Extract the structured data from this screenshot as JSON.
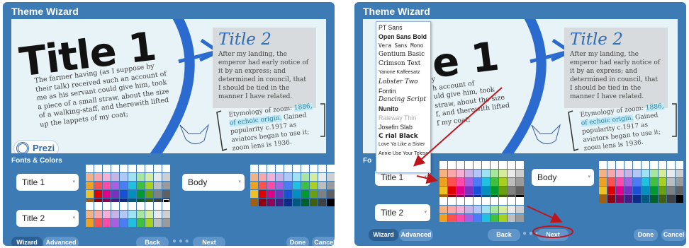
{
  "wizard": {
    "title": "Theme Wizard",
    "section_label": "Fonts & Colors",
    "section_label_short": "Fo",
    "tabs": [
      "Wizard",
      "Advanced"
    ],
    "nav": {
      "back": "Back",
      "next": "Next",
      "done": "Done",
      "cancel": "Cancel"
    }
  },
  "preview": {
    "title1": "Title 1",
    "title1_partial": "e 1",
    "body": "The farmer having (as I suppose by their talk) received such an account of me as his servant could give him, took a piece of a small straw, about the size of a walking-staff, and therewith lifted up the lappets of my coat;",
    "body_right_lines": [
      "y",
      "h account of",
      "uld give him, took",
      "straw, about the size",
      "f, and therewith lifted",
      "f my coat;"
    ],
    "title2": "Title 2",
    "title2_body": "After my landing, the emperor had early notice of it by an express; and determined in council, that I should be tied in the manner I have related.",
    "etymology_pre": "Etymology of zoom:",
    "etymology_highlight": "1886, of echoic origin.",
    "etymology_post": "Gained popularity c.1917 as aviators began to use it; zoom lens is 1936.",
    "logo_text": "Prezi"
  },
  "controls": {
    "title1_select": "Title 1",
    "title2_select": "Title 2",
    "body_select": "Body"
  },
  "font_list": [
    "PT Sans",
    "Open Sans Bold",
    "Vera Sans Mono",
    "Gentium Basic",
    "Crimson Text",
    "Yanone Kaffeesatz",
    "Lobster Two",
    "Fontin",
    "Dancing Script",
    "Nunito",
    "Raleway Thin",
    "Josefin Slab",
    "C rial Black",
    "Love Ya Like a Sister",
    "Annie Use Your Telescope"
  ],
  "palette_colors": [
    [
      "#ffffff",
      "#ffffff",
      "#ffffff",
      "#ffffff",
      "#ffffff",
      "#ffffff",
      "#ffffff",
      "#ffffff",
      "#ffffff",
      "#ffffff"
    ],
    [
      "#f4b183",
      "#f8a8a8",
      "#f3b0d4",
      "#c9b2e4",
      "#b3c7f7",
      "#9fe3f2",
      "#a8e6a0",
      "#d6ec9c",
      "#eaeaea",
      "#cfcfcf"
    ],
    [
      "#f0a020",
      "#ff5050",
      "#ff4aa8",
      "#a860e0",
      "#4a7cf7",
      "#20c0e0",
      "#40c040",
      "#a8d020",
      "#bdbdbd",
      "#9b9b9b"
    ],
    [
      "#f0c020",
      "#e00000",
      "#e0008a",
      "#7b30c0",
      "#1a50d8",
      "#0090c0",
      "#009a30",
      "#6aa010",
      "#808080",
      "#606060"
    ],
    [
      "#a06010",
      "#900010",
      "#900058",
      "#4a1a80",
      "#102888",
      "#005a80",
      "#00602a",
      "#406010",
      "#404040",
      "#000000"
    ]
  ],
  "colors": {
    "panel": "#3d7bb4",
    "preview_bg": "#e7f3f7",
    "arrow_blue": "#2b6bd0",
    "annotation_red": "#c0141c"
  }
}
